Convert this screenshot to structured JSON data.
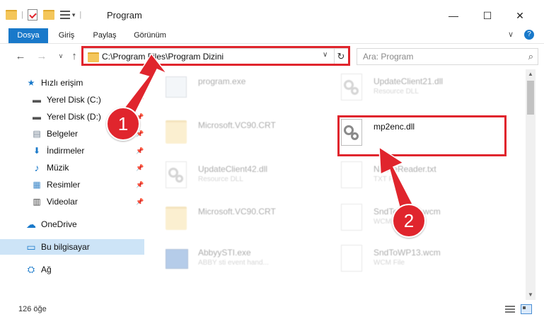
{
  "window": {
    "title": "Program",
    "min_glyph": "—",
    "max_glyph": "☐",
    "close_glyph": "✕",
    "help_glyph": "?",
    "expand_glyph": "∨",
    "qa_sep": "|",
    "qa_drop": "▾"
  },
  "ribbon": {
    "tabs": [
      "Dosya",
      "Giriş",
      "Paylaş",
      "Görünüm"
    ]
  },
  "nav": {
    "back": "←",
    "forward": "→",
    "recent": "∨",
    "up": "↑",
    "address": "C:\\Program Files\\Program Dizini",
    "address_drop": "∨",
    "refresh": "↻",
    "search_placeholder": "Ara: Program",
    "search_icon": "⌕"
  },
  "sidebar": {
    "items": [
      {
        "label": "Hızlı erişim",
        "icon": "star-icon",
        "glyph": "★",
        "color": "#1979ca",
        "pinned": false
      },
      {
        "label": "Yerel Disk (C:)",
        "icon": "drive-icon",
        "glyph": "▬",
        "color": "#555555",
        "pinned": true
      },
      {
        "label": "Yerel Disk (D:)",
        "icon": "drive-icon",
        "glyph": "▬",
        "color": "#555555",
        "pinned": true
      },
      {
        "label": "Belgeler",
        "icon": "documents-icon",
        "glyph": "▤",
        "color": "#6a7a8a",
        "pinned": true
      },
      {
        "label": "İndirmeler",
        "icon": "downloads-icon",
        "glyph": "⬇",
        "color": "#1979ca",
        "pinned": true
      },
      {
        "label": "Müzik",
        "icon": "music-icon",
        "glyph": "♪",
        "color": "#1979ca",
        "pinned": true
      },
      {
        "label": "Resimler",
        "icon": "pictures-icon",
        "glyph": "▦",
        "color": "#3a86c8",
        "pinned": true
      },
      {
        "label": "Videolar",
        "icon": "videos-icon",
        "glyph": "▥",
        "color": "#444444",
        "pinned": true
      },
      {
        "label": "OneDrive",
        "icon": "cloud-icon",
        "glyph": "☁",
        "color": "#1979ca",
        "pinned": false
      },
      {
        "label": "Bu bilgisayar",
        "icon": "computer-icon",
        "glyph": "▭",
        "color": "#1979ca",
        "pinned": false,
        "selected": true
      },
      {
        "label": "Ağ",
        "icon": "network-icon",
        "glyph": "⛭",
        "color": "#1979ca",
        "pinned": false
      }
    ],
    "pin_glyph": "📌"
  },
  "files": [
    {
      "name": "program.exe",
      "desc": "",
      "icon": "exe-icon",
      "faded": true
    },
    {
      "name": "UpdateClient21.dll",
      "desc": "Resource DLL",
      "icon": "dll-icon",
      "faded": true
    },
    {
      "name": "Microsoft.VC90.CRT",
      "desc": "",
      "icon": "folder-icon",
      "faded": true
    },
    {
      "name": "mp2enc.dll",
      "desc": "",
      "icon": "dll-icon",
      "faded": false
    },
    {
      "name": "UpdateClient42.dll",
      "desc": "Resource DLL",
      "icon": "dll-icon",
      "faded": true
    },
    {
      "name": "NativeReader.txt",
      "desc": "TXT File",
      "icon": "txt-icon",
      "faded": true
    },
    {
      "name": "Microsoft.VC90.CRT",
      "desc": "",
      "icon": "folder-icon",
      "faded": true
    },
    {
      "name": "SndToWP16.wcm",
      "desc": "WCM File",
      "icon": "wcm-icon",
      "faded": true
    },
    {
      "name": "AbbyySTI.exe",
      "desc": "ABBY sti event hand...",
      "icon": "exe-icon",
      "faded": true
    },
    {
      "name": "SndToWP13.wcm",
      "desc": "WCM File",
      "icon": "wcm-icon",
      "faded": true
    }
  ],
  "status": {
    "count": "126 öğe"
  },
  "annotations": {
    "badge1": "1",
    "badge2": "2",
    "highlight_color": "#e0252d"
  },
  "colors": {
    "accent": "#1979ca",
    "selection": "#cde4f7",
    "highlight": "#e0252d"
  }
}
